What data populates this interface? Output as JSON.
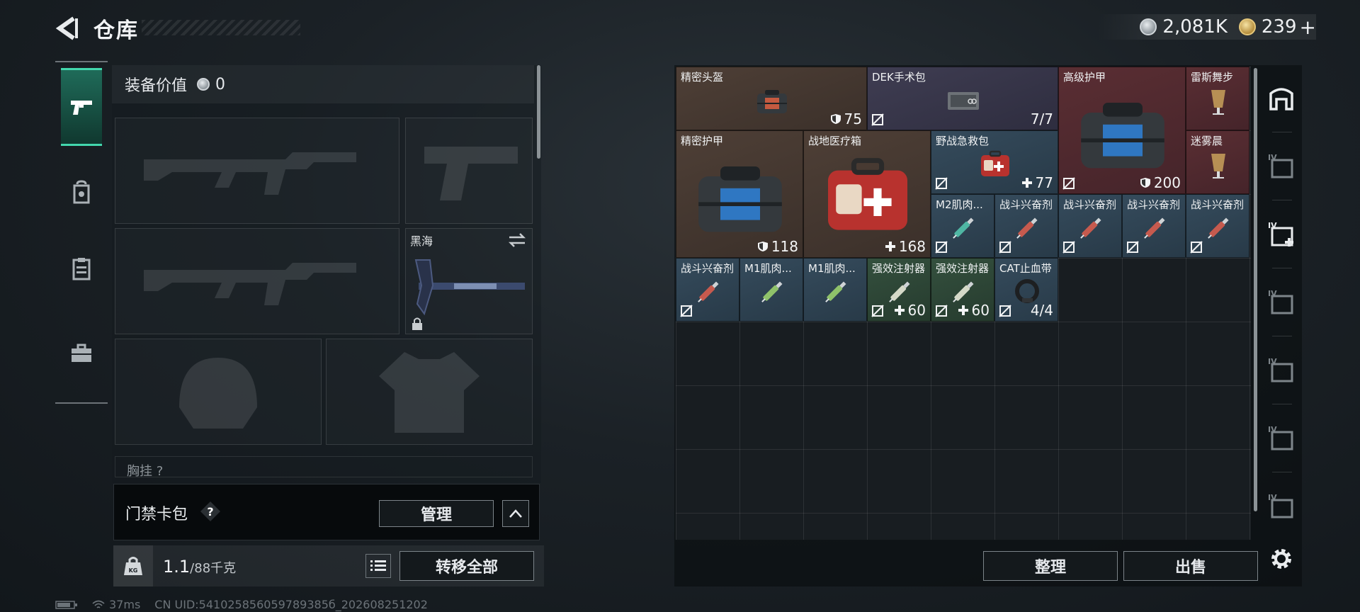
{
  "header": {
    "title": "仓库",
    "currencies": [
      {
        "icon": "silver-coin-icon",
        "value": "2,081K"
      },
      {
        "icon": "gold-coin-icon",
        "value": "239"
      }
    ],
    "add_symbol": "+"
  },
  "left_rail": {
    "items": [
      {
        "icon": "pistol-icon",
        "active": true
      },
      {
        "icon": "backpack-icon",
        "active": false
      },
      {
        "icon": "clipboard-icon",
        "active": false
      },
      {
        "icon": "briefcase-icon",
        "active": false
      }
    ]
  },
  "loadout": {
    "equip_value_label": "装备价值",
    "equip_value": "0",
    "melee_slot_name": "黑海",
    "chest_label": "胸挂",
    "chest_count": "?"
  },
  "card_bar": {
    "label": "门禁卡包",
    "help": "?",
    "manage_label": "管理"
  },
  "weight": {
    "icon_text": "KG",
    "current": "1.1",
    "capacity": "/88千克",
    "transfer_label": "转移全部"
  },
  "status": {
    "ping": "37ms",
    "uid": "CN UID:541025856059789385б_202608251202"
  },
  "storage": {
    "items": [
      {
        "name": "精密头盔",
        "qty": "75",
        "qty_icon": "shield",
        "insured": false,
        "color": "brown"
      },
      {
        "name": "DEK手术包",
        "qty": "7/7",
        "qty_icon": "",
        "insured": true,
        "color": "purple"
      },
      {
        "name": "高级护甲",
        "qty": "200",
        "qty_icon": "shield",
        "insured": true,
        "color": "red"
      },
      {
        "name": "雷斯舞步",
        "qty": "",
        "qty_icon": "",
        "insured": false,
        "color": "red"
      },
      {
        "name": "迷雾晨",
        "qty": "",
        "qty_icon": "",
        "insured": false,
        "color": "red"
      },
      {
        "name": "精密护甲",
        "qty": "118",
        "qty_icon": "shield",
        "insured": false,
        "color": "brown"
      },
      {
        "name": "战地医疗箱",
        "qty": "168",
        "qty_icon": "cross",
        "insured": false,
        "color": "brown"
      },
      {
        "name": "野战急救包",
        "qty": "77",
        "qty_icon": "cross",
        "insured": true,
        "color": "blue"
      },
      {
        "name": "M2肌肉...",
        "qty": "",
        "qty_icon": "",
        "insured": true,
        "color": "blue"
      },
      {
        "name": "战斗兴奋剂",
        "qty": "",
        "qty_icon": "",
        "insured": true,
        "color": "blue"
      },
      {
        "name": "战斗兴奋剂",
        "qty": "",
        "qty_icon": "",
        "insured": true,
        "color": "blue"
      },
      {
        "name": "战斗兴奋剂",
        "qty": "",
        "qty_icon": "",
        "insured": true,
        "color": "blue"
      },
      {
        "name": "战斗兴奋剂",
        "qty": "",
        "qty_icon": "",
        "insured": true,
        "color": "blue"
      },
      {
        "name": "战斗兴奋剂",
        "qty": "",
        "qty_icon": "",
        "insured": true,
        "color": "blue"
      },
      {
        "name": "M1肌肉...",
        "qty": "",
        "qty_icon": "",
        "insured": false,
        "color": "blue"
      },
      {
        "name": "M1肌肉...",
        "qty": "",
        "qty_icon": "",
        "insured": false,
        "color": "blue"
      },
      {
        "name": "强效注射器",
        "qty": "60",
        "qty_icon": "cross",
        "insured": true,
        "color": "green"
      },
      {
        "name": "强效注射器",
        "qty": "60",
        "qty_icon": "cross",
        "insured": true,
        "color": "green"
      },
      {
        "name": "CAT止血带",
        "qty": "4/4",
        "qty_icon": "",
        "insured": true,
        "color": "blue"
      }
    ],
    "arrange_label": "整理",
    "sell_label": "出售"
  },
  "right_rail": {
    "items": [
      {
        "icon": "safe-box-icon",
        "tier": ""
      },
      {
        "icon": "tier-case-icon",
        "tier": "IV"
      },
      {
        "icon": "medical-case-icon",
        "tier": "IV"
      },
      {
        "icon": "ammo-case-icon",
        "tier": "IV"
      },
      {
        "icon": "tool-case-icon",
        "tier": "IV"
      },
      {
        "icon": "camera-case-icon",
        "tier": "IV"
      },
      {
        "icon": "weapon-case-icon",
        "tier": "IV"
      }
    ],
    "settings_icon": "gear-icon"
  },
  "colors": {
    "accent": "#43d7ad",
    "panel": "#181d21",
    "rarity_brown": "#4e3f36",
    "rarity_purple": "#3f3d52",
    "rarity_red": "#5a2e33",
    "rarity_blue": "#354b5c",
    "rarity_green": "#34503e"
  }
}
